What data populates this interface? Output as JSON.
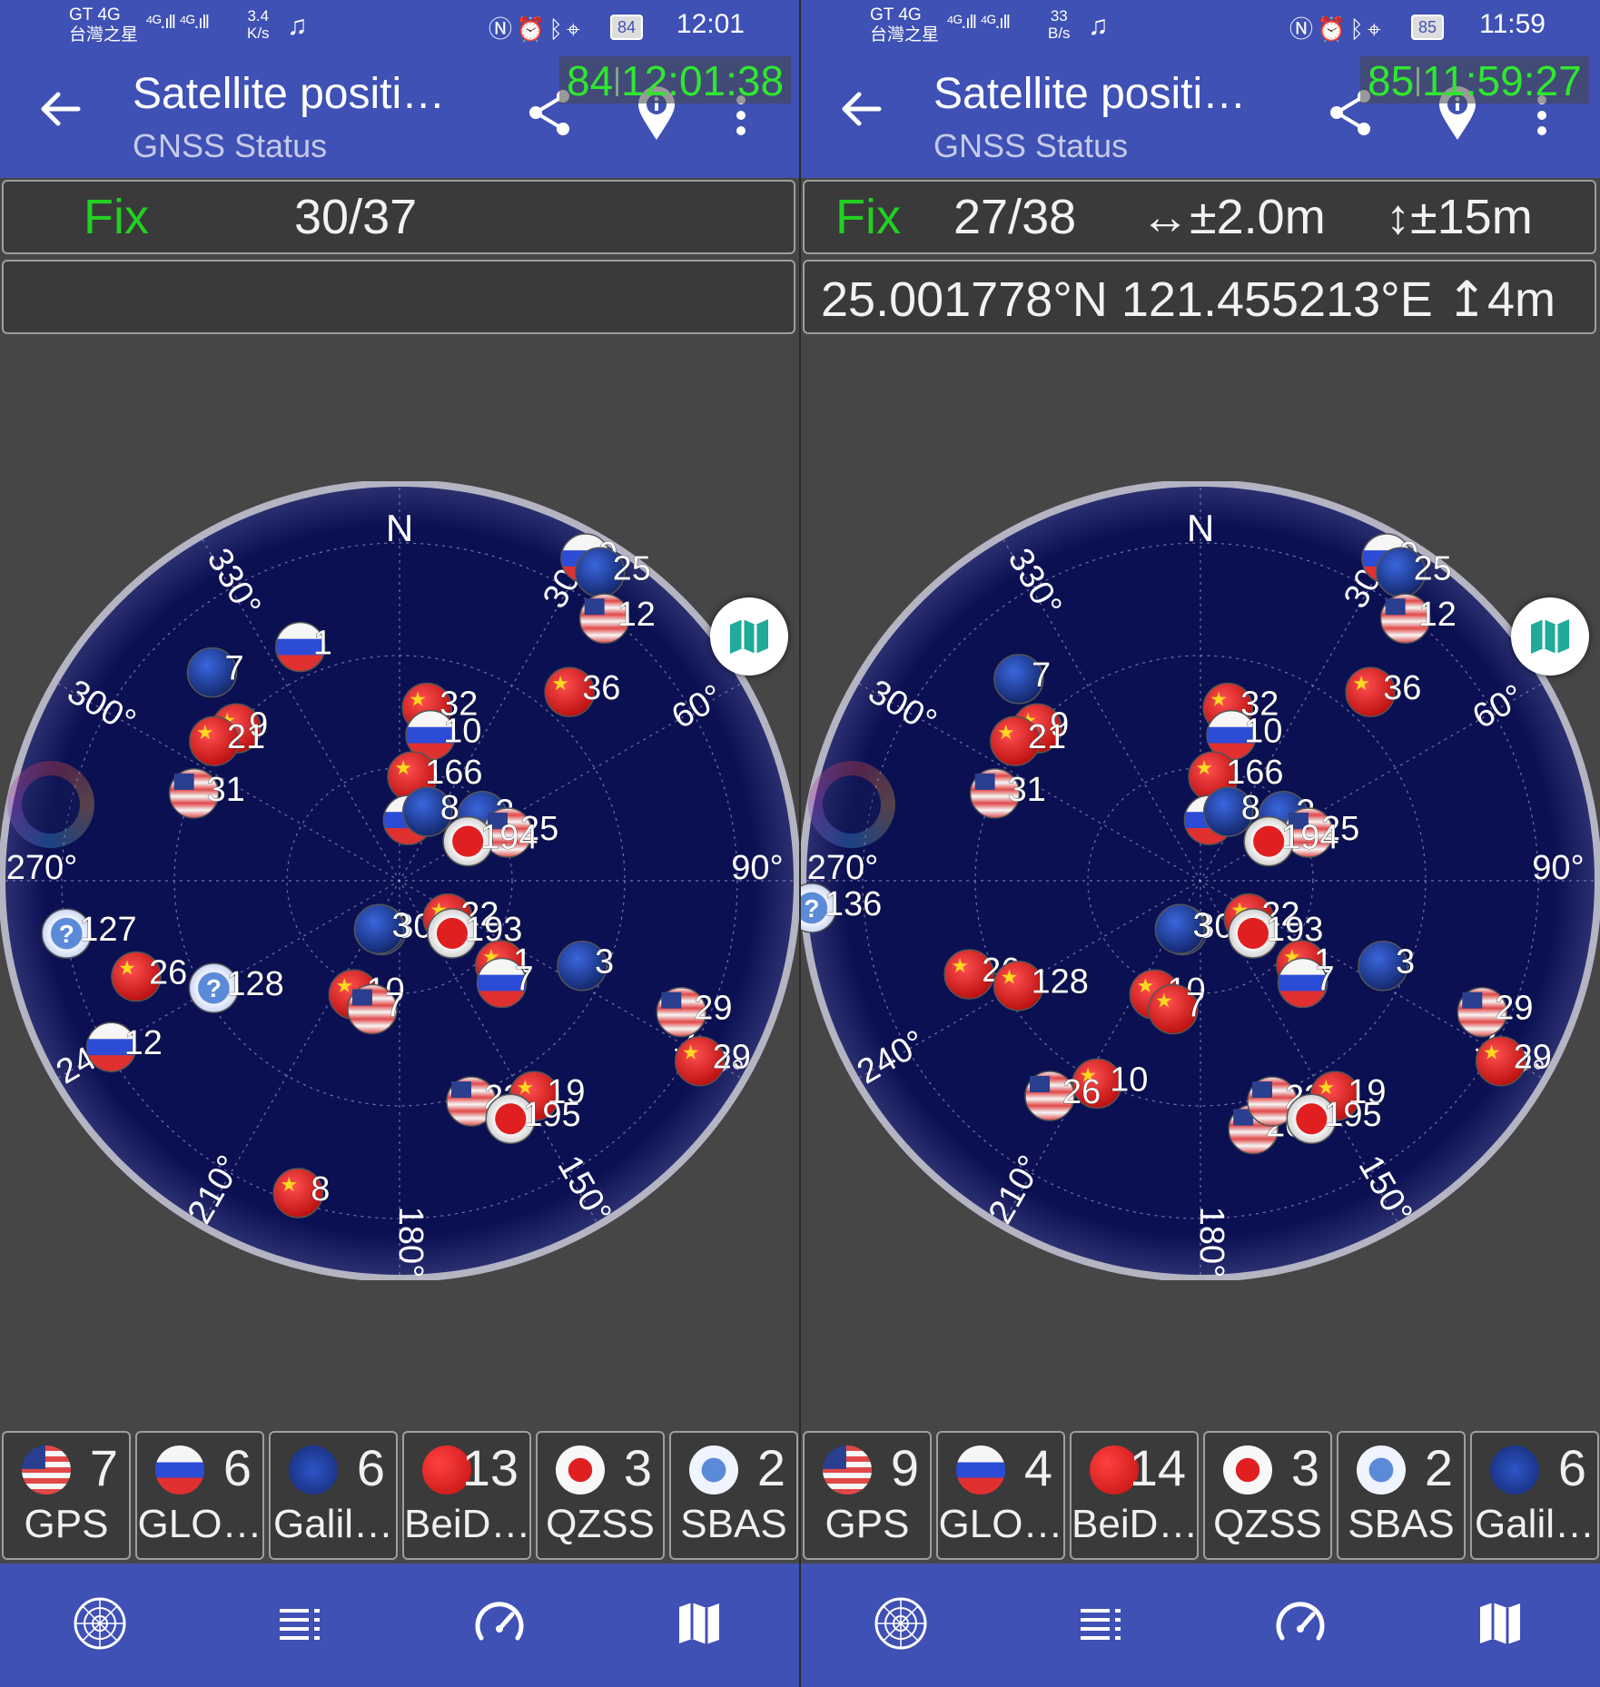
{
  "panels": [
    {
      "status": {
        "carrier_top": "GT 4G",
        "carrier_bottom": "台灣之星",
        "signal": "⁴ᴳ.ıll ⁴ᴳ.ıll",
        "speed_value": "3.4",
        "speed_unit": "K/s",
        "battery": "84",
        "time": "12:01"
      },
      "toolbar": {
        "title": "Satellite positi…",
        "subtitle": "GNSS Status",
        "overlay_battery": "84",
        "overlay_time": "12:01:38"
      },
      "fix": {
        "label": "Fix",
        "count": "30/37",
        "h_acc": "",
        "v_acc": ""
      },
      "location": "",
      "skyplot": {
        "north": "N",
        "labels": {
          "a30": "30°",
          "a60": "60°",
          "a90": "90°",
          "a120": "120°",
          "a150": "150°",
          "a180": "180°",
          "a210": "210°",
          "a240": "240°",
          "a270": "270°",
          "a300": "300°",
          "a330": "330°"
        },
        "satellites": [
          {
            "id": "9",
            "c": "ru",
            "az": 30,
            "el": 5
          },
          {
            "id": "25",
            "c": "eu",
            "az": 33,
            "el": 6
          },
          {
            "id": "12",
            "c": "us",
            "az": 38,
            "el": 14
          },
          {
            "id": "1",
            "c": "ru",
            "az": 337,
            "el": 32
          },
          {
            "id": "7",
            "c": "eu",
            "az": 318,
            "el": 26
          },
          {
            "id": "9",
            "c": "cn",
            "az": 313,
            "el": 39
          },
          {
            "id": "21",
            "c": "cn",
            "az": 307,
            "el": 37
          },
          {
            "id": "32",
            "c": "cn",
            "az": 9,
            "el": 50
          },
          {
            "id": "10",
            "c": "ru",
            "az": 12,
            "el": 56
          },
          {
            "id": "166",
            "c": "cn",
            "az": 7,
            "el": 66
          },
          {
            "id": "36",
            "c": "cn",
            "az": 42,
            "el": 32
          },
          {
            "id": "2",
            "c": "eu",
            "az": 52,
            "el": 66
          },
          {
            "id": "25",
            "c": "us",
            "az": 66,
            "el": 63
          },
          {
            "id": "31",
            "c": "us",
            "az": 293,
            "el": 39
          },
          {
            "id": "8",
            "c": "ru",
            "az": 8,
            "el": 76
          },
          {
            "id": "8",
            "c": "eu",
            "az": 22,
            "el": 73
          },
          {
            "id": "194",
            "c": "jp",
            "az": 60,
            "el": 72
          },
          {
            "id": "127",
            "c": "sb",
            "az": 261,
            "el": 13
          },
          {
            "id": "26",
            "c": "cn",
            "az": 250,
            "el": 26
          },
          {
            "id": "128",
            "c": "sb",
            "az": 240,
            "el": 41
          },
          {
            "id": "30",
            "c": "eu",
            "az": 200,
            "el": 78
          },
          {
            "id": "3",
            "c": "eu",
            "az": 203,
            "el": 78
          },
          {
            "id": "22",
            "c": "cn",
            "az": 128,
            "el": 76
          },
          {
            "id": "193",
            "c": "jp",
            "az": 135,
            "el": 73
          },
          {
            "id": "1",
            "c": "cn",
            "az": 130,
            "el": 60
          },
          {
            "id": "7",
            "c": "ru",
            "az": 135,
            "el": 57
          },
          {
            "id": "3",
            "c": "eu",
            "az": 115,
            "el": 44
          },
          {
            "id": "10",
            "c": "cn",
            "az": 202,
            "el": 62
          },
          {
            "id": "7",
            "c": "us",
            "az": 192,
            "el": 60
          },
          {
            "id": "29",
            "c": "us",
            "az": 115,
            "el": 19
          },
          {
            "id": "29",
            "c": "cn",
            "az": 121,
            "el": 10
          },
          {
            "id": "12",
            "c": "ru",
            "az": 240,
            "el": 14
          },
          {
            "id": "23",
            "c": "us",
            "az": 162,
            "el": 37
          },
          {
            "id": "19",
            "c": "cn",
            "az": 148,
            "el": 32
          },
          {
            "id": "195",
            "c": "jp",
            "az": 155,
            "el": 30
          },
          {
            "id": "8",
            "c": "cn",
            "az": 198,
            "el": 15
          }
        ]
      },
      "constellations": [
        {
          "c": "us",
          "count": "7",
          "name": "GPS"
        },
        {
          "c": "ru",
          "count": "6",
          "name": "GLO…"
        },
        {
          "c": "eu",
          "count": "6",
          "name": "Galil…"
        },
        {
          "c": "cn",
          "count": "13",
          "name": "BeiD…"
        },
        {
          "c": "jp",
          "count": "3",
          "name": "QZSS"
        },
        {
          "c": "sb",
          "count": "2",
          "name": "SBAS"
        }
      ]
    },
    {
      "status": {
        "carrier_top": "GT 4G",
        "carrier_bottom": "台灣之星",
        "signal": "⁴ᴳ.ıll ⁴ᴳ.ıll",
        "speed_value": "33",
        "speed_unit": "B/s",
        "battery": "85",
        "time": "11:59"
      },
      "toolbar": {
        "title": "Satellite positi…",
        "subtitle": "GNSS Status",
        "overlay_battery": "85",
        "overlay_time": "11:59:27"
      },
      "fix": {
        "label": "Fix",
        "count": "27/38",
        "h_acc": "↔±2.0m",
        "v_acc": "↕±15m"
      },
      "location": "25.001778°N 121.455213°E ↥4m",
      "skyplot": {
        "north": "N",
        "labels": {
          "a30": "30°",
          "a60": "60°",
          "a90": "90°",
          "a120": "120°",
          "a150": "150°",
          "a180": "180°",
          "a210": "210°",
          "a240": "240°",
          "a270": "270°",
          "a300": "300°",
          "a330": "330°"
        },
        "satellites": [
          {
            "id": "9",
            "c": "ru",
            "az": 30,
            "el": 5
          },
          {
            "id": "25",
            "c": "eu",
            "az": 33,
            "el": 6
          },
          {
            "id": "12",
            "c": "us",
            "az": 38,
            "el": 14
          },
          {
            "id": "7",
            "c": "eu",
            "az": 318,
            "el": 28
          },
          {
            "id": "9",
            "c": "cn",
            "az": 313,
            "el": 39
          },
          {
            "id": "21",
            "c": "cn",
            "az": 307,
            "el": 37
          },
          {
            "id": "32",
            "c": "cn",
            "az": 9,
            "el": 50
          },
          {
            "id": "10",
            "c": "ru",
            "az": 12,
            "el": 56
          },
          {
            "id": "166",
            "c": "cn",
            "az": 7,
            "el": 66
          },
          {
            "id": "36",
            "c": "cn",
            "az": 42,
            "el": 32
          },
          {
            "id": "2",
            "c": "eu",
            "az": 52,
            "el": 66
          },
          {
            "id": "25",
            "c": "us",
            "az": 66,
            "el": 63
          },
          {
            "id": "31",
            "c": "us",
            "az": 293,
            "el": 39
          },
          {
            "id": "8",
            "c": "ru",
            "az": 8,
            "el": 76
          },
          {
            "id": "8",
            "c": "eu",
            "az": 22,
            "el": 73
          },
          {
            "id": "194",
            "c": "jp",
            "az": 60,
            "el": 72
          },
          {
            "id": "136",
            "c": "sb",
            "az": 266,
            "el": 1
          },
          {
            "id": "26",
            "c": "cn",
            "az": 248,
            "el": 33
          },
          {
            "id": "128",
            "c": "cn",
            "az": 240,
            "el": 42
          },
          {
            "id": "30",
            "c": "eu",
            "az": 200,
            "el": 78
          },
          {
            "id": "3",
            "c": "eu",
            "az": 203,
            "el": 78
          },
          {
            "id": "22",
            "c": "cn",
            "az": 128,
            "el": 76
          },
          {
            "id": "193",
            "c": "jp",
            "az": 135,
            "el": 73
          },
          {
            "id": "1",
            "c": "cn",
            "az": 130,
            "el": 60
          },
          {
            "id": "7",
            "c": "ru",
            "az": 135,
            "el": 57
          },
          {
            "id": "3",
            "c": "eu",
            "az": 115,
            "el": 44
          },
          {
            "id": "10",
            "c": "cn",
            "az": 202,
            "el": 62
          },
          {
            "id": "7",
            "c": "cn",
            "az": 192,
            "el": 60
          },
          {
            "id": "29",
            "c": "us",
            "az": 115,
            "el": 19
          },
          {
            "id": "29",
            "c": "cn",
            "az": 121,
            "el": 10
          },
          {
            "id": "10",
            "c": "cn",
            "az": 207,
            "el": 38
          },
          {
            "id": "26",
            "c": "us",
            "az": 215,
            "el": 30
          },
          {
            "id": "20",
            "c": "us",
            "az": 168,
            "el": 32
          },
          {
            "id": "23",
            "c": "us",
            "az": 162,
            "el": 37
          },
          {
            "id": "19",
            "c": "cn",
            "az": 148,
            "el": 32
          },
          {
            "id": "195",
            "c": "jp",
            "az": 155,
            "el": 30
          }
        ]
      },
      "constellations": [
        {
          "c": "us",
          "count": "9",
          "name": "GPS"
        },
        {
          "c": "ru",
          "count": "4",
          "name": "GLO…"
        },
        {
          "c": "cn",
          "count": "14",
          "name": "BeiD…"
        },
        {
          "c": "jp",
          "count": "3",
          "name": "QZSS"
        },
        {
          "c": "sb",
          "count": "2",
          "name": "SBAS"
        },
        {
          "c": "eu",
          "count": "6",
          "name": "Galil…"
        }
      ]
    }
  ],
  "icons": {
    "back": "arrow-left-icon",
    "share": "share-icon",
    "pin": "location-info-icon",
    "more": "more-vertical-icon",
    "map3d": "map-3d-icon",
    "nav": [
      "radar-icon",
      "list-icon",
      "speedometer-icon",
      "map-icon"
    ]
  },
  "colors": {
    "appbar": "#3f51b5",
    "fix_green": "#22d022",
    "overlay_green": "#2ee82e",
    "sky_bg": "#0b1052"
  }
}
